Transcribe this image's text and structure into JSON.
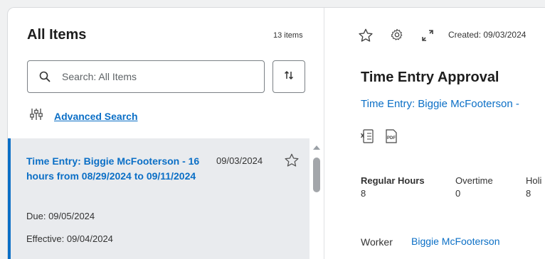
{
  "list": {
    "title": "All Items",
    "count": "13 items",
    "search_placeholder": "Search: All Items",
    "advanced_search": "Advanced Search",
    "items": [
      {
        "title": "Time Entry: Biggie McFooterson - 16 hours from 08/29/2024 to 09/11/2024",
        "date": "09/03/2024",
        "due": "Due: 09/05/2024",
        "effective": "Effective: 09/04/2024"
      }
    ]
  },
  "detail": {
    "created": "Created: 09/03/2024",
    "title": "Time Entry Approval",
    "subtitle": "Time Entry: Biggie McFooterson -",
    "metrics": [
      {
        "label": "Regular Hours",
        "value": "8"
      },
      {
        "label": "Overtime",
        "value": "0"
      },
      {
        "label": "Holi",
        "value": "8"
      }
    ],
    "worker_label": "Worker",
    "worker_value": "Biggie McFooterson"
  },
  "icons": [
    "search-icon",
    "sort-icon",
    "filter-sliders-icon",
    "star-icon",
    "gear-icon",
    "expand-icon",
    "excel-export-icon",
    "pdf-export-icon"
  ],
  "colors": {
    "accent": "#0b6fc6",
    "selected_bg": "#e9ebee"
  }
}
